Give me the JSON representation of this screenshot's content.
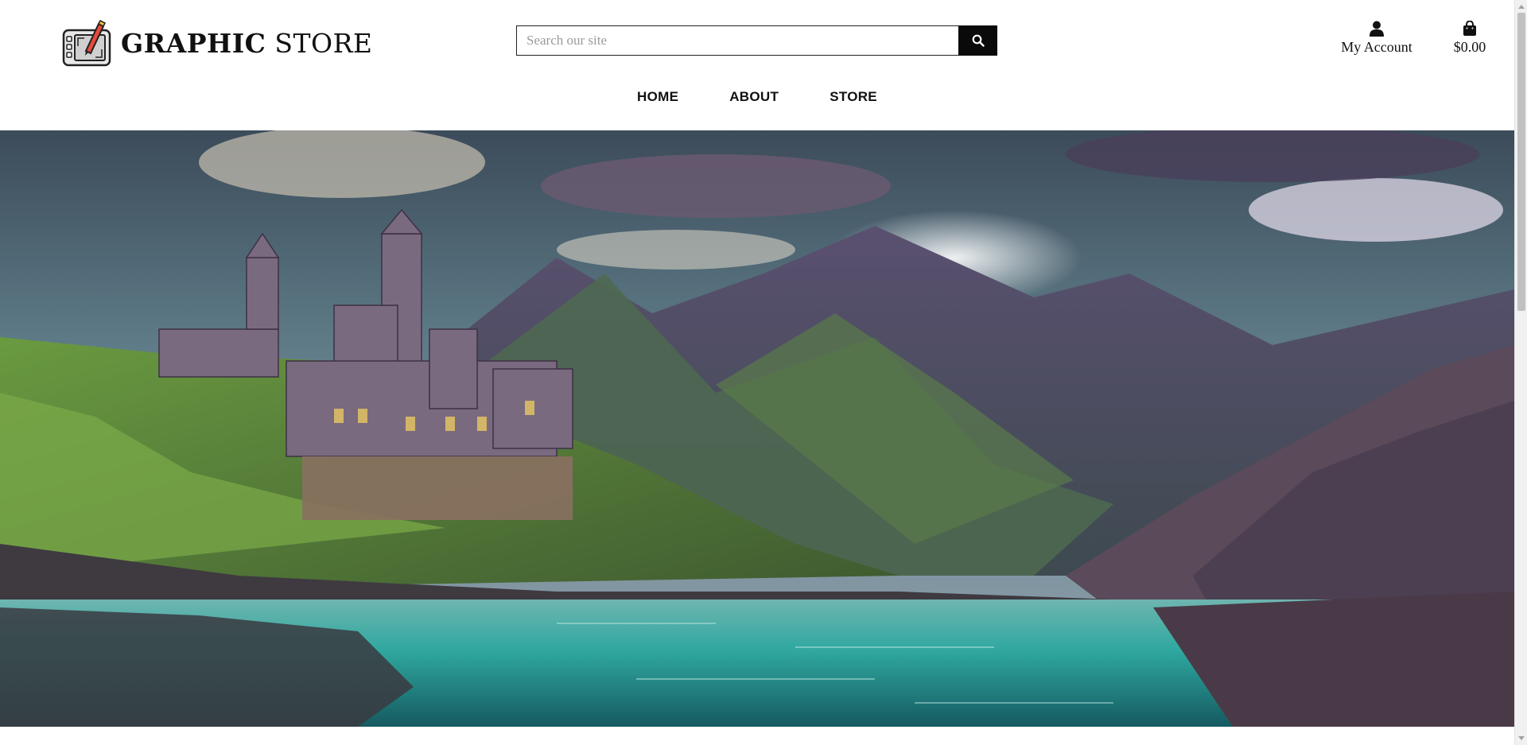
{
  "brand": {
    "name_bold": "GRAPHIC",
    "name_regular": "STORE",
    "logo_icon": "drawing-tablet-icon"
  },
  "search": {
    "placeholder": "Search our site",
    "value": "",
    "button_icon": "search-icon"
  },
  "account": {
    "label": "My Account",
    "icon": "user-icon"
  },
  "cart": {
    "total": "$0.00",
    "icon": "shopping-bag-icon"
  },
  "nav": {
    "items": [
      {
        "label": "HOME"
      },
      {
        "label": "ABOUT"
      },
      {
        "label": "STORE"
      }
    ]
  },
  "hero": {
    "image": "fantasy-castle-lake-landscape"
  },
  "colors": {
    "accent": "#0a0a0a",
    "background": "#ffffff",
    "text": "#111111"
  }
}
